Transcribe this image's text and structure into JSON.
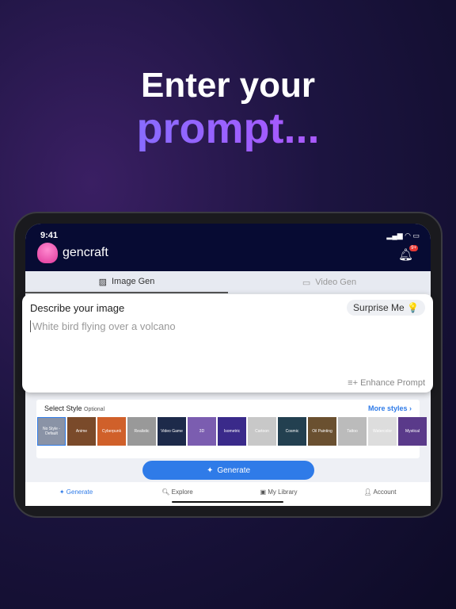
{
  "headline": {
    "line1": "Enter your",
    "line2": "prompt..."
  },
  "status": {
    "time": "9:41",
    "icons": "signal wifi battery"
  },
  "app": {
    "name": "gencraft",
    "badge": "9+"
  },
  "tabs": [
    {
      "label": "Image Gen",
      "icon": "image-icon"
    },
    {
      "label": "Video Gen",
      "icon": "video-icon"
    }
  ],
  "prompt": {
    "label": "Describe your image",
    "surprise": "Surprise Me 💡",
    "placeholder": "White bird flying over a volcano",
    "enhance": "Enhance Prompt"
  },
  "styles": {
    "title": "Select Style",
    "optional": "Optional",
    "more": "More styles ›",
    "items": [
      "No Style - Default",
      "Anime",
      "Cyberpunk",
      "Realistic",
      "Video Game",
      "3D",
      "Isometric",
      "Cartoon",
      "Cosmic",
      "Oil Painting",
      "Tattoo",
      "Watercolor",
      "Mystical"
    ]
  },
  "generate": "Generate",
  "nav": [
    "Generate",
    "Explore",
    "My Library",
    "Account"
  ],
  "colors": {
    "accent": "#2f7be8",
    "topbar": "#070b33"
  }
}
